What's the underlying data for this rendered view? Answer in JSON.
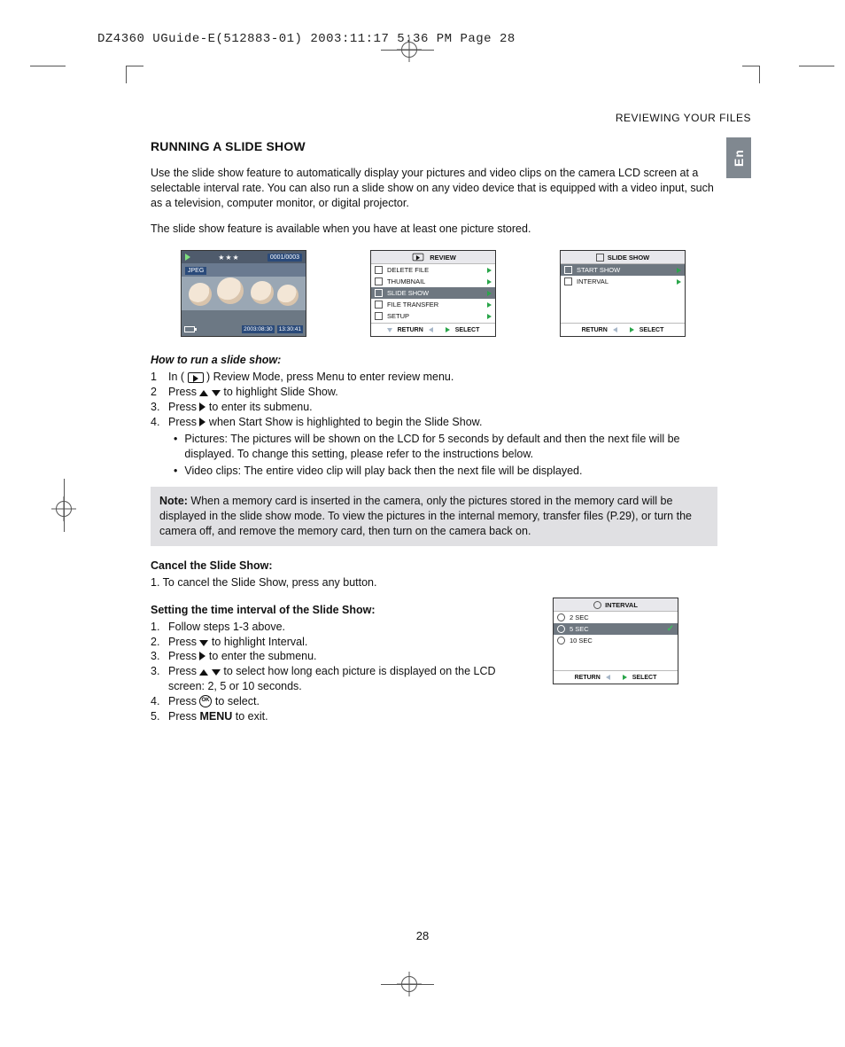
{
  "print_header": "DZ4360 UGuide-E(512883-01)  2003:11:17  5:36 PM  Page 28",
  "section_header": "REVIEWING YOUR FILES",
  "lang_tab": "En",
  "title": "RUNNING A SLIDE SHOW",
  "intro1": "Use the slide show feature to automatically display your pictures and video clips on the camera LCD screen at a selectable interval rate. You can also run a slide show on any video device that is equipped with a video input, such as a television, computer monitor, or digital projector.",
  "intro2": "The slide show feature is available when you have at least one picture stored.",
  "lcd_photo": {
    "counter": "0001/0003",
    "jpeg": "JPEG",
    "date": "2003:08:30",
    "time": "13:30:41"
  },
  "lcd_review": {
    "title": "REVIEW",
    "items": [
      "DELETE FILE",
      "THUMBNAIL",
      "SLIDE SHOW",
      "FILE TRANSFER",
      "SETUP"
    ],
    "return": "RETURN",
    "select": "SELECT"
  },
  "lcd_slideshow": {
    "title": "SLIDE SHOW",
    "items": [
      "START SHOW",
      "INTERVAL"
    ],
    "return": "RETURN",
    "select": "SELECT"
  },
  "howto_heading": "How to run a slide show:",
  "howto_steps": {
    "s1a": "In (",
    "s1b": ") Review Mode, press Menu to enter review menu.",
    "s2a": "Press",
    "s2b": "to highlight Slide Show.",
    "s3a": "Press",
    "s3b": "to enter its submenu.",
    "s4a": "Press",
    "s4b": "when Start Show is highlighted to begin the Slide Show."
  },
  "howto_bullets": [
    "Pictures: The pictures will be shown on the LCD for 5 seconds by default and then the next file will be displayed. To change this setting, please refer to the instructions below.",
    "Video clips: The entire video clip will play back then the next file will be displayed."
  ],
  "note_label": "Note:",
  "note_text": " When a memory card is inserted in the camera, only the pictures stored in the memory card will be displayed in the slide show mode. To view the pictures in the internal memory, transfer files (P.29), or turn the camera off, and remove the memory card, then turn on the camera back on.",
  "cancel_heading": "Cancel the Slide Show:",
  "cancel_step": "1. To cancel the Slide Show, press any button.",
  "setint_heading": "Setting the time interval of the Slide Show:",
  "setint_steps": {
    "s1": "Follow steps 1-3 above.",
    "s2a": "Press",
    "s2b": "to highlight Interval.",
    "s3a": "Press",
    "s3b": "to enter the submenu.",
    "s3c": "Press",
    "s3d": "to select how long each picture is displayed on the LCD screen: 2, 5 or 10 seconds.",
    "s4a": "Press",
    "s4b": "to select.",
    "s5a": "Press",
    "s5b": "MENU",
    "s5c": "to exit."
  },
  "lcd_interval": {
    "title": "INTERVAL",
    "items": [
      "2   SEC",
      "5   SEC",
      "10 SEC"
    ],
    "return": "RETURN",
    "select": "SELECT"
  },
  "page_number": "28"
}
